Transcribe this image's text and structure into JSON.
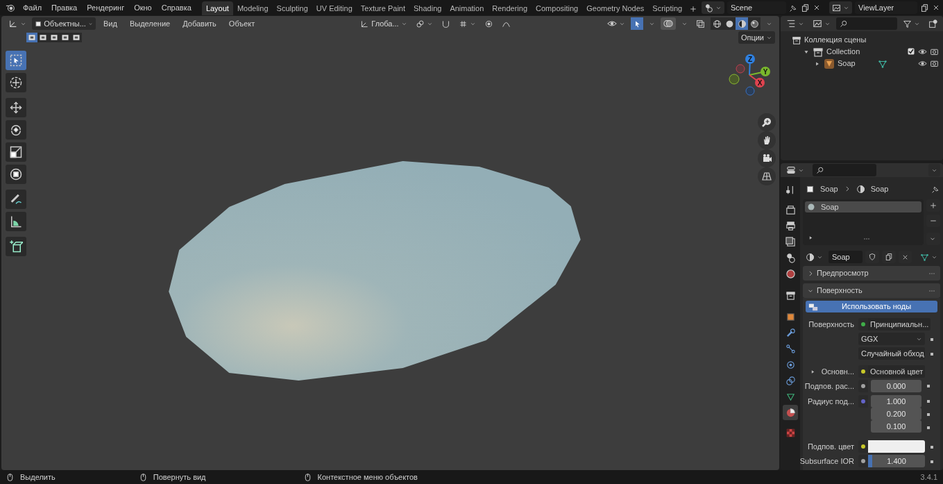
{
  "menu": [
    "Файл",
    "Правка",
    "Рендеринг",
    "Окно",
    "Справка"
  ],
  "workspaces": [
    {
      "label": "Layout",
      "selected": true
    },
    {
      "label": "Modeling",
      "selected": false
    },
    {
      "label": "Sculpting",
      "selected": false
    },
    {
      "label": "UV Editing",
      "selected": false
    },
    {
      "label": "Texture Paint",
      "selected": false
    },
    {
      "label": "Shading",
      "selected": false
    },
    {
      "label": "Animation",
      "selected": false
    },
    {
      "label": "Rendering",
      "selected": false
    },
    {
      "label": "Compositing",
      "selected": false
    },
    {
      "label": "Geometry Nodes",
      "selected": false
    },
    {
      "label": "Scripting",
      "selected": false
    }
  ],
  "scene": "Scene",
  "view_layer": "ViewLayer",
  "viewport": {
    "mode": "Объектны...",
    "menus": [
      "Вид",
      "Выделение",
      "Добавить",
      "Объект"
    ],
    "orientation": "Глоба...",
    "options": "Опции",
    "select_modes": [
      {
        "selected": true
      },
      {
        "selected": false
      },
      {
        "selected": false
      },
      {
        "selected": false
      },
      {
        "selected": false
      }
    ],
    "gizmo_toggle": {
      "on": true
    },
    "overlay_toggle": {
      "on": true
    },
    "shading": [
      {
        "selected": false
      },
      {
        "selected": false
      },
      {
        "selected": true
      },
      {
        "selected": false
      }
    ],
    "tools": [
      {
        "selected": true
      },
      {
        "selected": false
      },
      {
        "selected": false
      },
      {
        "selected": false
      },
      {
        "selected": false
      },
      {
        "selected": false
      },
      {
        "selected": false
      },
      {
        "selected": false
      },
      {
        "selected": false
      }
    ],
    "axes": [
      "Z",
      "Y",
      "X"
    ]
  },
  "outliner": {
    "items": [
      {
        "label": "Коллекция сцены",
        "children": [
          {
            "label": "Collection",
            "expanded": true,
            "checked": true,
            "children": [
              {
                "label": "Soap",
                "expanded": false
              }
            ]
          }
        ]
      }
    ]
  },
  "properties": {
    "tabs": [
      {
        "selected": false
      },
      {
        "selected": false
      },
      {
        "selected": false
      },
      {
        "selected": false
      },
      {
        "selected": false
      },
      {
        "selected": false
      },
      {
        "selected": false
      },
      {
        "selected": false
      },
      {
        "selected": false
      },
      {
        "selected": false
      },
      {
        "selected": false
      },
      {
        "selected": false
      },
      {
        "selected": false
      },
      {
        "selected": true
      },
      {
        "selected": false
      }
    ],
    "breadcrumb": [
      "Soap",
      "Soap"
    ],
    "slots": [
      {
        "name": "Soap",
        "selected": true
      }
    ],
    "material": "Soap",
    "panels": [
      {
        "title": "Предпросмотр",
        "expanded": false
      },
      {
        "title": "Поверхность",
        "expanded": true
      }
    ],
    "use_nodes": "Использовать ноды",
    "rows": [
      {
        "kind": "link",
        "label": "Поверхность",
        "value": "Принципиальн...",
        "color": "#3fae49"
      },
      {
        "kind": "dropdown",
        "value": "GGX"
      },
      {
        "kind": "dropdown",
        "value": "Случайный обход"
      },
      {
        "kind": "link",
        "label": "Основн...",
        "value": "Основной цвет",
        "color": "#c7c729",
        "expanded": false
      },
      {
        "kind": "number",
        "label": "Подпов. рас...",
        "values": [
          "0.000"
        ],
        "color": "#a1a1a1"
      },
      {
        "kind": "number",
        "label": "Радиус под...",
        "values": [
          "1.000",
          "0.200",
          "0.100"
        ],
        "color": "#6363c7"
      },
      {
        "kind": "swatch",
        "label": "Подпов. цвет",
        "color": "#c7c729"
      },
      {
        "kind": "slider",
        "label": "Subsurface IOR",
        "value": "1.400",
        "level": 0.07,
        "color": "#a1a1a1"
      }
    ]
  },
  "status_bar": {
    "hints": [
      "Выделить",
      "Повернуть вид",
      "Контекстное меню объектов"
    ],
    "version": "3.4.1"
  }
}
